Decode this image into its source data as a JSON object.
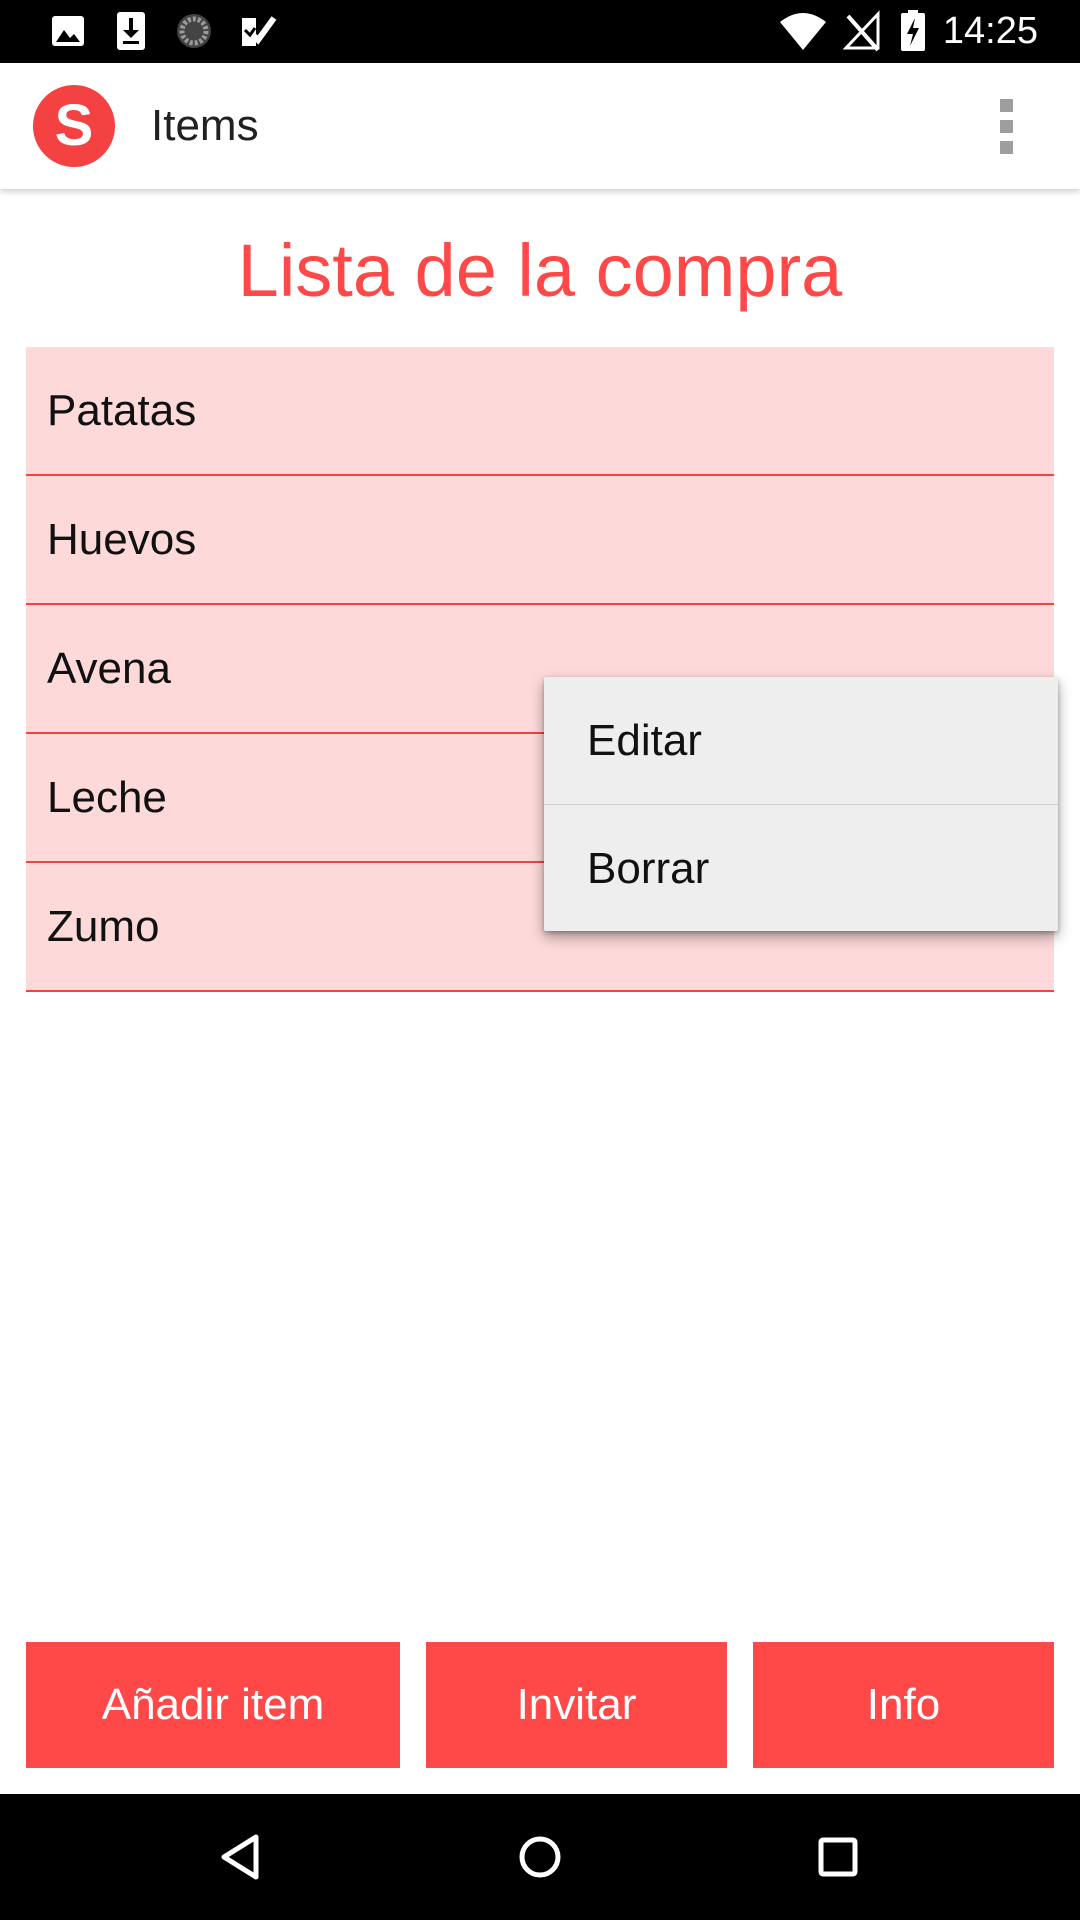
{
  "status_bar": {
    "time": "14:25",
    "left_icons": [
      "image-icon",
      "download-icon",
      "sync-icon",
      "checklist-icon"
    ],
    "right_icons": [
      "wifi-icon",
      "no-signal-icon",
      "battery-charging-icon"
    ]
  },
  "app_bar": {
    "logo_letter": "S",
    "title": "Items",
    "overflow_icon": "more-vert-icon"
  },
  "heading": "Lista de la compra",
  "items": [
    {
      "label": "Patatas"
    },
    {
      "label": "Huevos"
    },
    {
      "label": "Avena"
    },
    {
      "label": "Leche"
    },
    {
      "label": "Zumo"
    }
  ],
  "context_menu": {
    "options": [
      {
        "label": "Editar"
      },
      {
        "label": "Borrar"
      }
    ]
  },
  "buttons": {
    "add": "Añadir item",
    "invite": "Invitar",
    "info": "Info"
  },
  "nav_bar": {
    "icons": [
      "back-icon",
      "home-icon",
      "recents-icon"
    ]
  },
  "colors": {
    "accent": "#ff4848",
    "item_background": "#fdd9d9",
    "divider": "#f0443f",
    "menu_background": "#eeeeee"
  }
}
